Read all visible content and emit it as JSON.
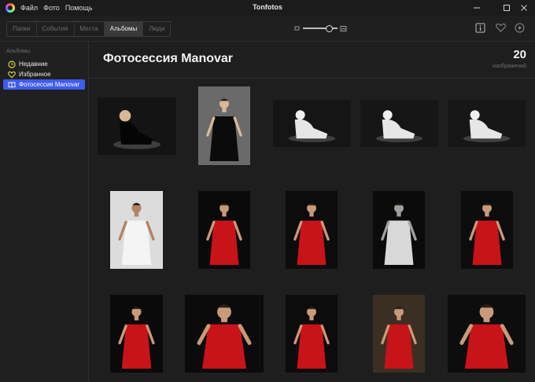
{
  "titlebar": {
    "menu": [
      "Файл",
      "Фото",
      "Помощь"
    ],
    "title": "Tonfotos"
  },
  "toolbar": {
    "tabs": [
      "Папки",
      "События",
      "Места",
      "Альбомы",
      "Люди"
    ],
    "active_tab": "Альбомы",
    "zoom_level": 0.75
  },
  "sidebar": {
    "title": "Альбомы",
    "items": [
      {
        "label": "Недавние",
        "icon": "clock-icon",
        "color": "#d6d640"
      },
      {
        "label": "Избранное",
        "icon": "heart-icon",
        "color": "#d6d640"
      },
      {
        "label": "Фотосессия Manovar",
        "icon": "book-icon",
        "color": "#ffffff",
        "selected": true
      }
    ]
  },
  "main": {
    "title": "Фотосессия Manovar",
    "count": "20",
    "count_label": "изображений"
  },
  "colors": {
    "accent": "#3d5cf0",
    "background": "#1e1e1e",
    "favorite": "#d6d640"
  },
  "photos": [
    {
      "id": 1,
      "bg": "#141414",
      "subject": "#d9b899",
      "dress": "#050505"
    },
    {
      "id": 2,
      "bg": "#6a6a6a",
      "subject": "#d9b899",
      "dress": "#0b0b0b"
    },
    {
      "id": 3,
      "bg": "#151515",
      "subject": "#efefef",
      "dress": "#e6e6e6"
    },
    {
      "id": 4,
      "bg": "#161616",
      "subject": "#efefef",
      "dress": "#e6e6e6"
    },
    {
      "id": 5,
      "bg": "#171717",
      "subject": "#efefef",
      "dress": "#e6e6e6"
    },
    {
      "id": 6,
      "bg": "#dcdcdc",
      "subject": "#b08466",
      "dress": "#f4f4f4"
    },
    {
      "id": 7,
      "bg": "#0a0a0a",
      "subject": "#c89a7a",
      "dress": "#c8131a"
    },
    {
      "id": 8,
      "bg": "#0c0c0c",
      "subject": "#c89a7a",
      "dress": "#c8131a"
    },
    {
      "id": 9,
      "bg": "#0b0b0b",
      "subject": "#a0a0a0",
      "dress": "#d8d8d8"
    },
    {
      "id": 10,
      "bg": "#0c0c0c",
      "subject": "#c89a7a",
      "dress": "#c8131a"
    },
    {
      "id": 11,
      "bg": "#0a0a0a",
      "subject": "#c89a7a",
      "dress": "#c8131a"
    },
    {
      "id": 12,
      "bg": "#0b0b0b",
      "subject": "#c89a7a",
      "dress": "#c8131a"
    },
    {
      "id": 13,
      "bg": "#0c0c0c",
      "subject": "#c89a7a",
      "dress": "#c8131a"
    },
    {
      "id": 14,
      "bg": "#3a2f22",
      "subject": "#c89a7a",
      "dress": "#c8131a"
    },
    {
      "id": 15,
      "bg": "#0d0d0d",
      "subject": "#c89a7a",
      "dress": "#c8131a"
    }
  ]
}
